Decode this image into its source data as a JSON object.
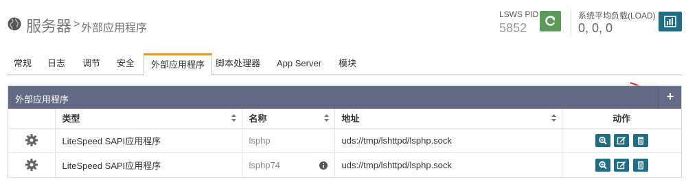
{
  "header": {
    "title": "服务器",
    "separator": ">",
    "subtitle": "外部应用程序",
    "pid_label": "LSWS PID",
    "pid_value": "5852",
    "load_label": "系统平均负载(LOAD)",
    "load_value": "0, 0, 0"
  },
  "tabs": [
    {
      "label": "常规"
    },
    {
      "label": "日志"
    },
    {
      "label": "调节"
    },
    {
      "label": "安全"
    },
    {
      "label": "外部应用程序",
      "active": true
    },
    {
      "label": "脚本处理器"
    },
    {
      "label": "App Server"
    },
    {
      "label": "模块"
    }
  ],
  "panel": {
    "title": "外部应用程序",
    "add_label": "+"
  },
  "table": {
    "columns": [
      "",
      "类型",
      "名称",
      "地址",
      "动作"
    ],
    "rows": [
      {
        "type": "LiteSpeed SAPI应用程序",
        "name": "lsphp",
        "address": "uds://tmp/lshttpd/lsphp.sock"
      },
      {
        "type": "LiteSpeed SAPI应用程序",
        "name": "lsphp74",
        "address": "uds://tmp/lshttpd/lsphp.sock"
      }
    ]
  },
  "colors": {
    "accent_tab": "#e5943a",
    "panel_header": "#626a85",
    "action_button": "#1f6e86",
    "reload_button": "#5a9a5a",
    "annotation_arrow": "#e02020"
  },
  "icons": {
    "header": "globe-icon",
    "reload": "refresh-icon",
    "stats": "bar-chart-icon",
    "add": "plus-icon",
    "row_settings": "gear-icon",
    "actions": [
      "view-icon",
      "edit-icon",
      "delete-icon"
    ],
    "name_info": "info-icon"
  }
}
